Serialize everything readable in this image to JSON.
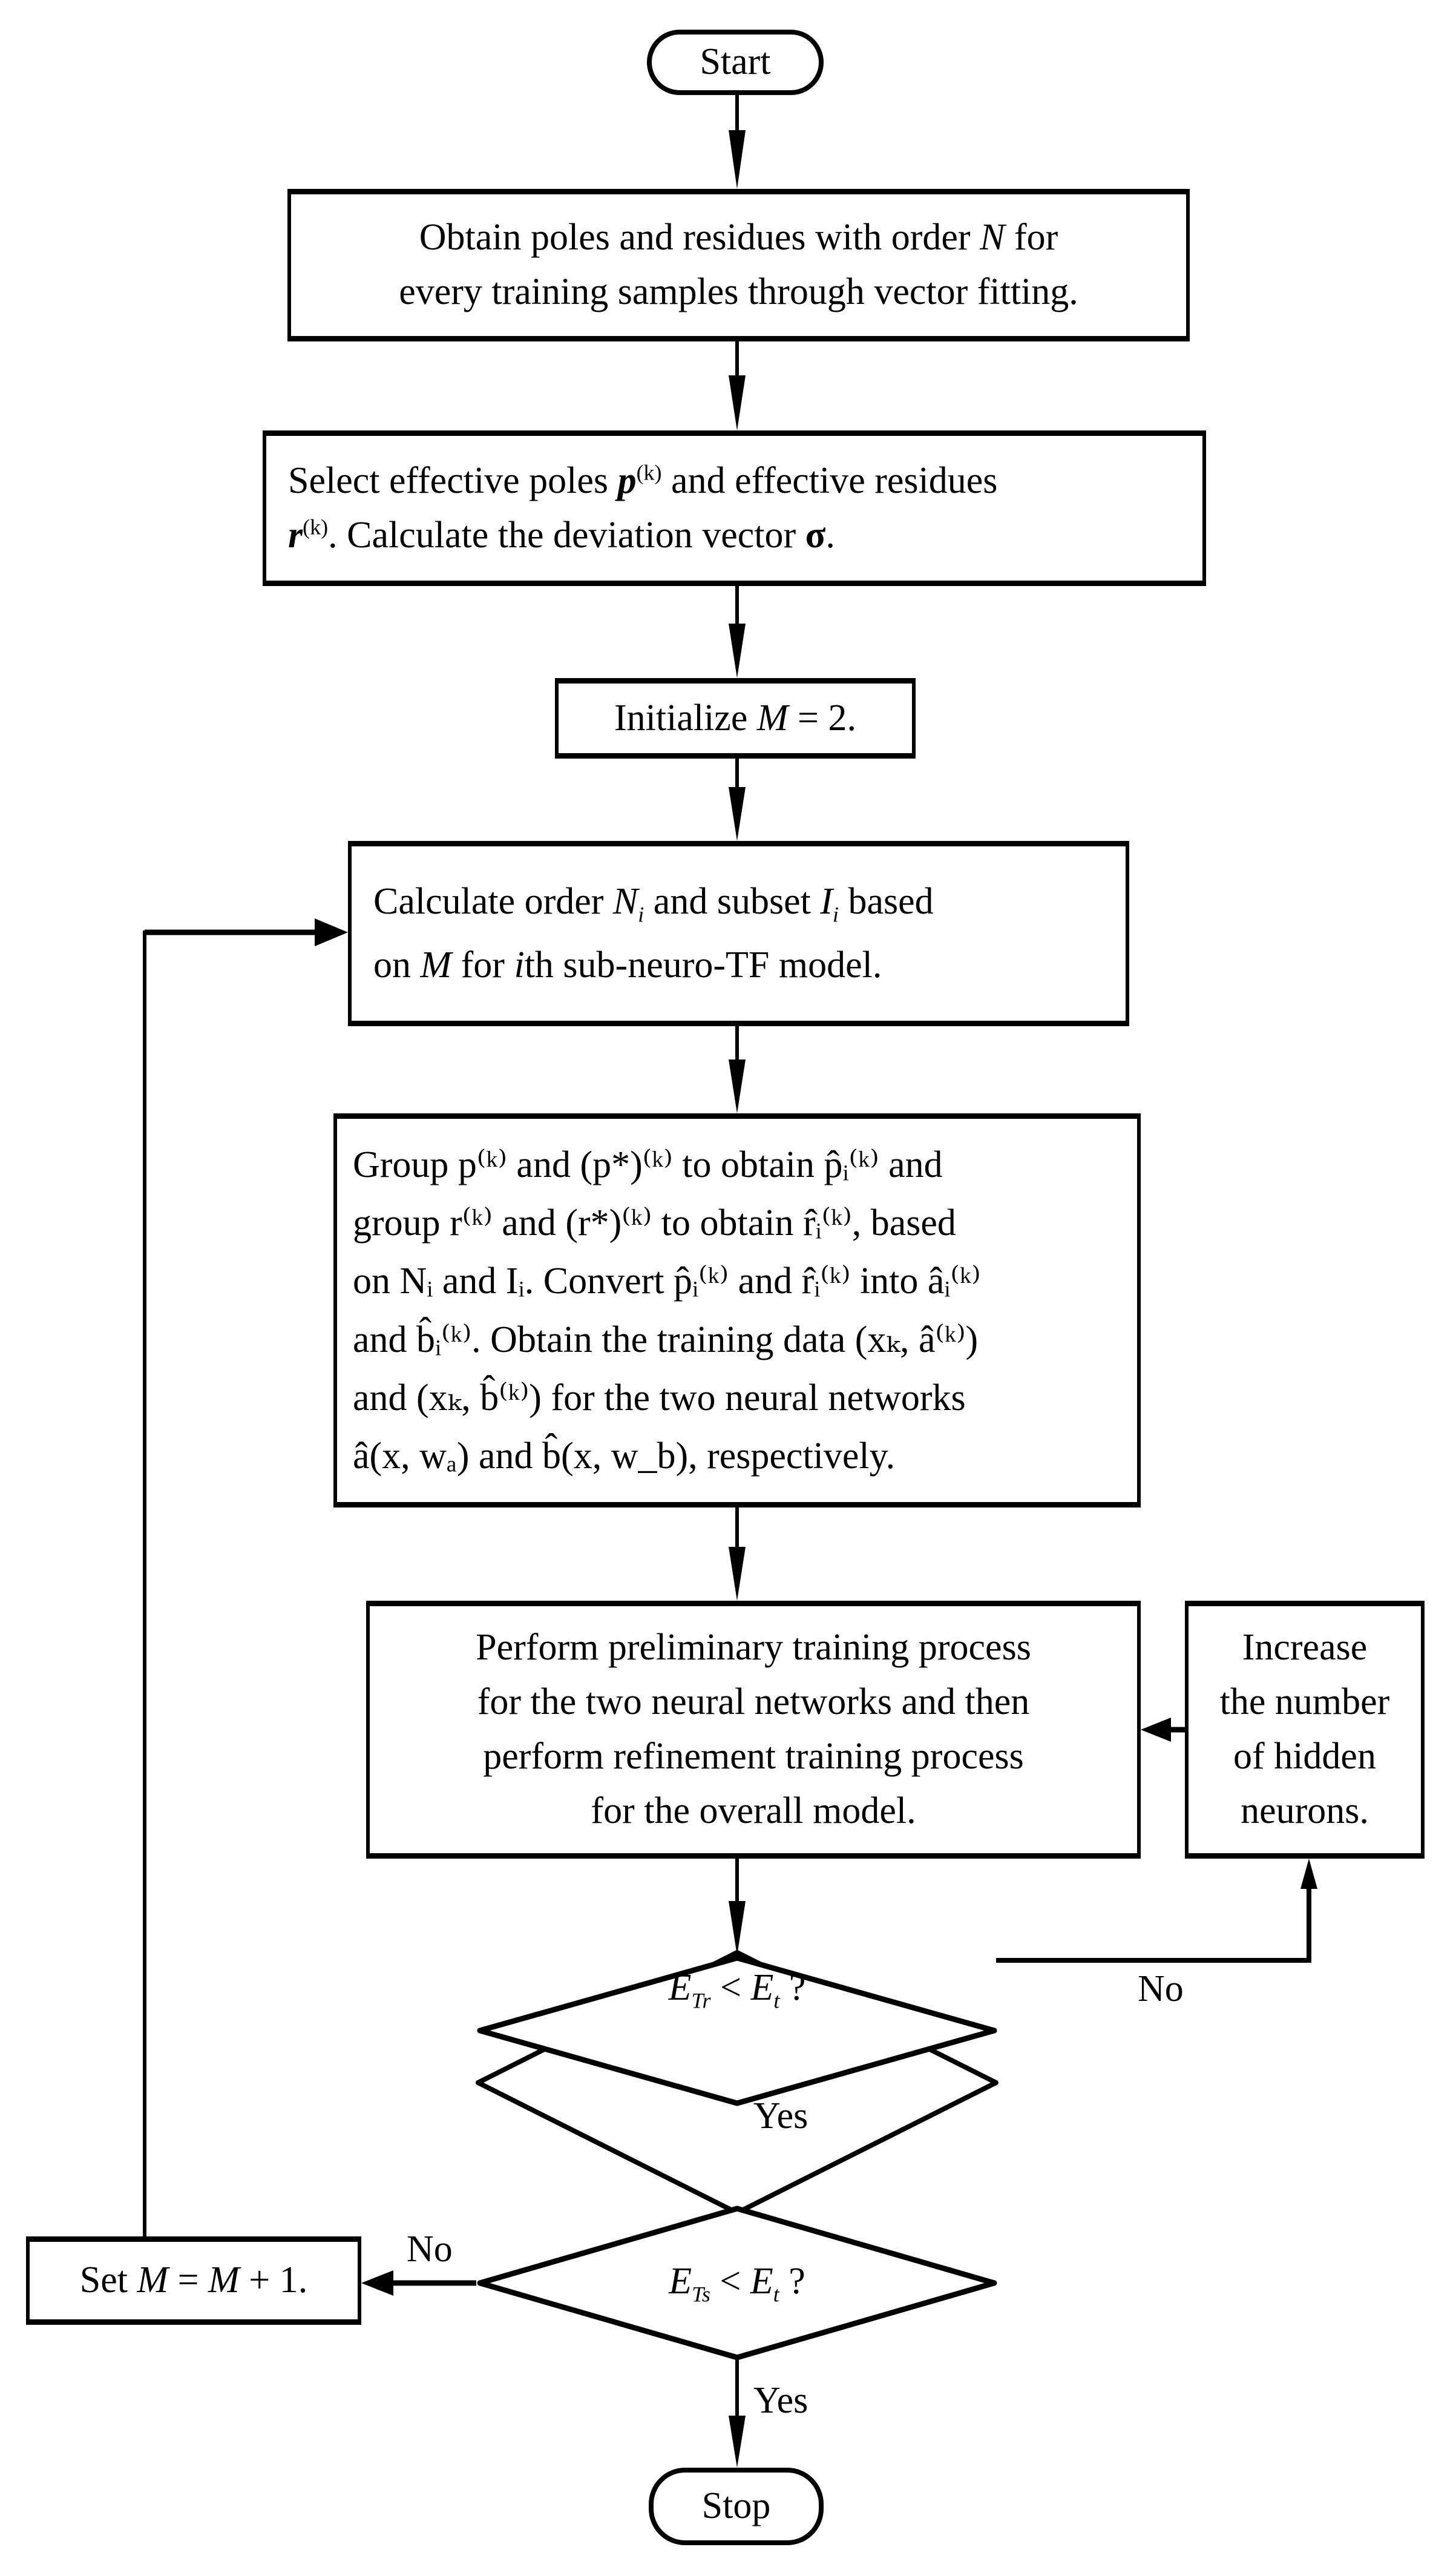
{
  "flowchart": {
    "start": "Start",
    "stop": "Stop",
    "steps": {
      "vector_fitting": {
        "line1_a": "Obtain poles and residues with order ",
        "line1_var": "N",
        "line1_b": " for",
        "line2": "every training samples through vector fitting."
      },
      "select_effective": {
        "line1_a": "Select effective poles ",
        "p": "p",
        "k_sup": "(k)",
        "line1_b": " and effective residues",
        "r": "r",
        "line2_b": ". Calculate the deviation vector ",
        "sigma": "σ",
        "period": "."
      },
      "initialize": {
        "text": "Initialize ",
        "var": "M",
        "rest": " = 2."
      },
      "calculate_order": {
        "line1_a": "Calculate order ",
        "N": "N",
        "i": "i",
        "line1_b": " and subset ",
        "I": "I",
        "line1_c": " based",
        "line2_a": "on ",
        "M": "M",
        "line2_b": " for ",
        "line2_c": "th sub-neuro-TF model."
      },
      "group": {
        "lines": [
          "Group p⁽ᵏ⁾ and (p*)⁽ᵏ⁾ to obtain p̂ᵢ⁽ᵏ⁾ and",
          "group r⁽ᵏ⁾ and (r*)⁽ᵏ⁾ to obtain r̂ᵢ⁽ᵏ⁾, based",
          "on Nᵢ and Iᵢ. Convert p̂ᵢ⁽ᵏ⁾ and r̂ᵢ⁽ᵏ⁾ into âᵢ⁽ᵏ⁾",
          "and b̂ᵢ⁽ᵏ⁾. Obtain the training data (xₖ, â⁽ᵏ⁾)",
          "and (xₖ, b̂⁽ᵏ⁾) for the two neural networks",
          "â(x, wₐ) and b̂(x, w_b), respectively."
        ]
      },
      "training": {
        "lines": [
          "Perform preliminary training process",
          "for the two neural networks and then",
          "perform refinement training process",
          "for the overall model."
        ]
      },
      "increase_neurons": {
        "lines": [
          "Increase",
          "the number",
          "of hidden",
          "neurons."
        ]
      },
      "set_m": {
        "a": "Set ",
        "var": "M",
        "b": " = ",
        "var2": "M",
        "c": " + 1."
      }
    },
    "decisions": {
      "train_error": {
        "E": "E",
        "sub1": "Tr",
        "op": " < ",
        "E2": "E",
        "sub2": "t",
        "q": " ?"
      },
      "test_error": {
        "E": "E",
        "sub1": "Ts",
        "op": " < ",
        "E2": "E",
        "sub2": "t",
        "q": " ?"
      }
    },
    "edge_labels": {
      "train_no": "No",
      "train_yes": "Yes",
      "test_no": "No",
      "test_yes": "Yes"
    }
  }
}
